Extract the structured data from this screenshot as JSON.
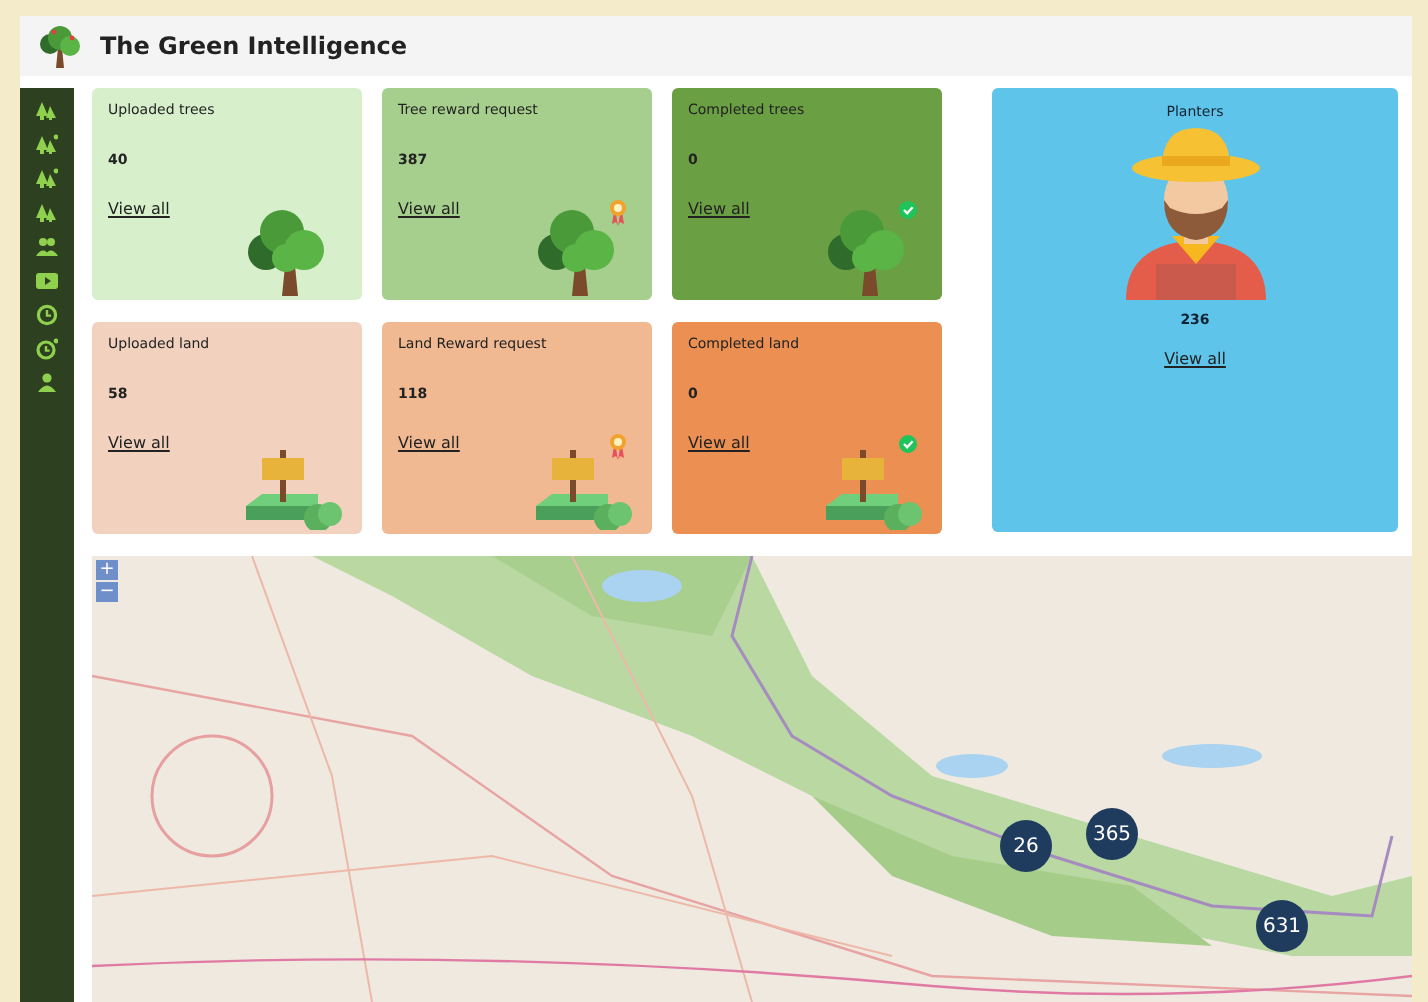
{
  "header": {
    "title": "The Green Intelligence"
  },
  "cards": [
    {
      "title": "Uploaded trees",
      "count": "40",
      "link": "View all",
      "color": "#d7f0cb",
      "kind": "tree",
      "rewarded": false,
      "completed": false
    },
    {
      "title": "Tree reward request",
      "count": "387",
      "link": "View all",
      "color": "#a6cf8d",
      "kind": "tree",
      "rewarded": true,
      "completed": false
    },
    {
      "title": "Completed trees",
      "count": "0",
      "link": "View all",
      "color": "#6a9f44",
      "kind": "tree",
      "rewarded": false,
      "completed": true
    },
    {
      "title": "Uploaded land",
      "count": "58",
      "link": "View all",
      "color": "#f2d2bf",
      "kind": "land",
      "rewarded": false,
      "completed": false
    },
    {
      "title": "Land Reward request",
      "count": "118",
      "link": "View all",
      "color": "#f0b992",
      "kind": "land",
      "rewarded": true,
      "completed": false
    },
    {
      "title": "Completed land",
      "count": "0",
      "link": "View all",
      "color": "#eb8f52",
      "kind": "land",
      "rewarded": false,
      "completed": true
    }
  ],
  "planters": {
    "title": "Planters",
    "count": "236",
    "link": "View all"
  },
  "map": {
    "zoom_in": "+",
    "zoom_out": "−",
    "clusters": [
      {
        "count": "26"
      },
      {
        "count": "365"
      },
      {
        "count": "631"
      }
    ]
  }
}
